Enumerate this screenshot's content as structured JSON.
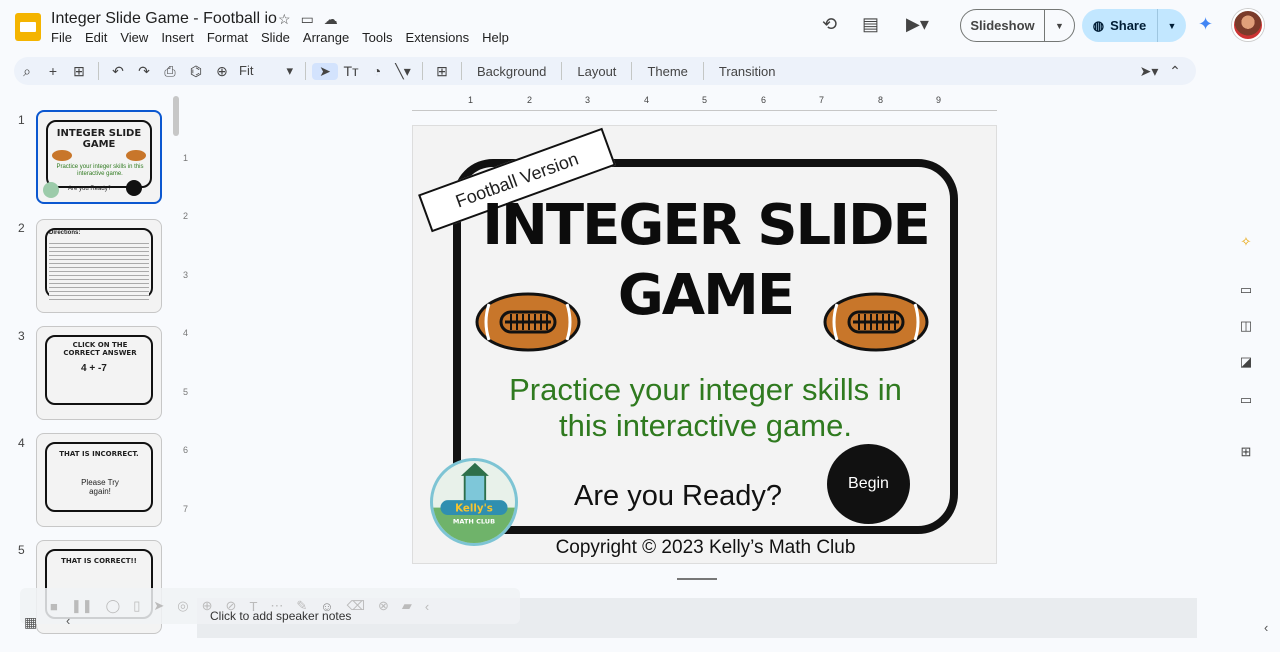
{
  "app": {
    "doc_title": "Integer Slide Game - Football io",
    "menu": [
      "File",
      "Edit",
      "View",
      "Insert",
      "Format",
      "Slide",
      "Arrange",
      "Tools",
      "Extensions",
      "Help"
    ],
    "slideshow_label": "Slideshow",
    "share_label": "Share",
    "accent": "#0b57d0",
    "share_bg": "#c2e7ff"
  },
  "toolbar": {
    "zoom": "Fit",
    "background": "Background",
    "layout": "Layout",
    "theme": "Theme",
    "transition": "Transition"
  },
  "rulers": {
    "h": [
      "1",
      "2",
      "3",
      "4",
      "5",
      "6",
      "7",
      "8",
      "9"
    ],
    "v": [
      "1",
      "2",
      "3",
      "4",
      "5",
      "6",
      "7"
    ]
  },
  "filmstrip": [
    {
      "num": "1",
      "title": "INTEGER SLIDE GAME",
      "sub": "Practice your integer skills in this interactive game.",
      "foot": "Are you Ready?",
      "selected": true
    },
    {
      "num": "2",
      "title": "Directions:",
      "sub": "",
      "foot": "",
      "selected": false
    },
    {
      "num": "3",
      "title": "CLICK ON THE CORRECT ANSWER",
      "sub": "4 + -7",
      "foot": "",
      "selected": false
    },
    {
      "num": "4",
      "title": "THAT IS INCORRECT.",
      "sub": "Please Try again!",
      "foot": "",
      "selected": false
    },
    {
      "num": "5",
      "title": "THAT IS CORRECT!!",
      "sub": "",
      "foot": "",
      "selected": false
    }
  ],
  "slide": {
    "badge": "Football Version",
    "title_line1": "INTEGER SLIDE",
    "title_line2": "GAME",
    "subtitle_line1": "Practice your integer skills in",
    "subtitle_line2": "this interactive game.",
    "ready": "Are you Ready?",
    "begin": "Begin",
    "logo_text": "Kelly's",
    "logo_sub": "MATH CLUB",
    "copyright": "Copyright © 2023 Kelly’s Math Club",
    "subtitle_color": "#2f7a1f"
  },
  "notes": {
    "placeholder": "Click to add speaker notes"
  },
  "icons": [
    "slides-logo",
    "star-icon",
    "folder-icon",
    "cloud-icon",
    "history-icon",
    "comment-icon",
    "video-icon",
    "gemini-icon",
    "avatar"
  ]
}
